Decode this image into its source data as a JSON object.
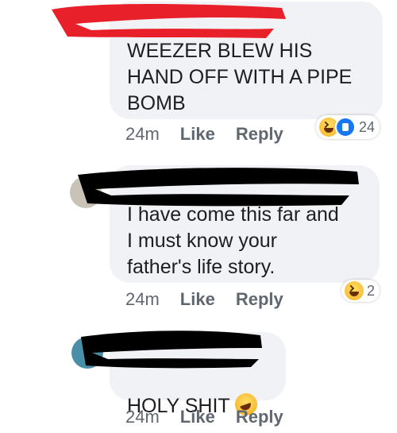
{
  "comments": [
    {
      "text": "WEEZER BLEW HIS\nHAND OFF WITH A PIPE\nBOMB",
      "time": "24m",
      "like_label": "Like",
      "reply_label": "Reply",
      "reaction_count": "24",
      "reaction_icons": [
        "haha-icon",
        "like-icon"
      ],
      "redaction_color": "#e8202a"
    },
    {
      "text": "I have come this far and\nI must know your\nfather's life story.",
      "time": "24m",
      "like_label": "Like",
      "reply_label": "Reply",
      "reaction_count": "2",
      "reaction_icons": [
        "haha-icon"
      ],
      "redaction_color": "#000000"
    },
    {
      "text": "HOLY SHIT",
      "time": "24m",
      "like_label": "Like",
      "reply_label": "Reply",
      "inline_emoji": "rolling-on-floor-laughing-icon",
      "redaction_color": "#000000"
    }
  ]
}
